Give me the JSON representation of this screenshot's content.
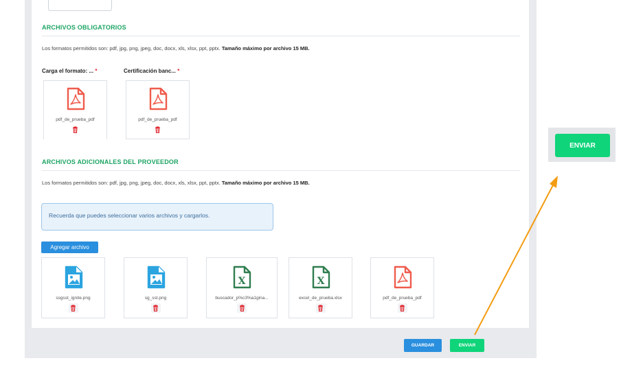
{
  "required_section": {
    "title": "ARCHIVOS OBLIGATORIOS",
    "formats_text": "Los formatos permitidos son: pdf, jpg, png, jpeg, doc, docx, xls, xlsx, ppt, pptx.",
    "max_size_text": "Tamaño máximo por archivo 15 MB.",
    "fields": [
      {
        "label": "Carga el formato: ...",
        "required_mark": "*",
        "file_name": "pdf_de_prueba_pdf",
        "file_type": "pdf"
      },
      {
        "label": "Certificación banc...",
        "required_mark": "*",
        "file_name": "pdf_de_prueba_pdf",
        "file_type": "pdf"
      }
    ]
  },
  "additional_section": {
    "title": "ARCHIVOS ADICIONALES DEL PROVEEDOR",
    "formats_text": "Los formatos permitidos son: pdf, jpg, png, jpeg, doc, docx, xls, xlsx, ppt, pptx.",
    "max_size_text": "Tamaño máximo por archivo 15 MB.",
    "info_text": "Recuerda que puedes seleccionar varios archivos y cargarlos.",
    "add_button_label": "Agregar archivo",
    "files": [
      {
        "name": "ssgsst_ignite.png",
        "type": "image"
      },
      {
        "name": "sg_sst.png",
        "type": "image"
      },
      {
        "name": "buscador_p%c3%a1gina...",
        "type": "excel"
      },
      {
        "name": "excel_de_prueba.xlsx",
        "type": "excel"
      },
      {
        "name": "pdf_de_prueba_pdf",
        "type": "pdf"
      }
    ]
  },
  "footer": {
    "save_label": "GUARDAR",
    "send_label": "ENVIAR"
  },
  "callout": {
    "send_label": "ENVIAR"
  },
  "colors": {
    "accent_green": "#0fd47a",
    "section_green": "#1ca463",
    "primary_blue": "#2a8fde",
    "pdf_red": "#ef5b4c",
    "image_blue": "#2ba4e0",
    "excel_green": "#2f7d4f",
    "arrow_orange": "#f39c12"
  }
}
